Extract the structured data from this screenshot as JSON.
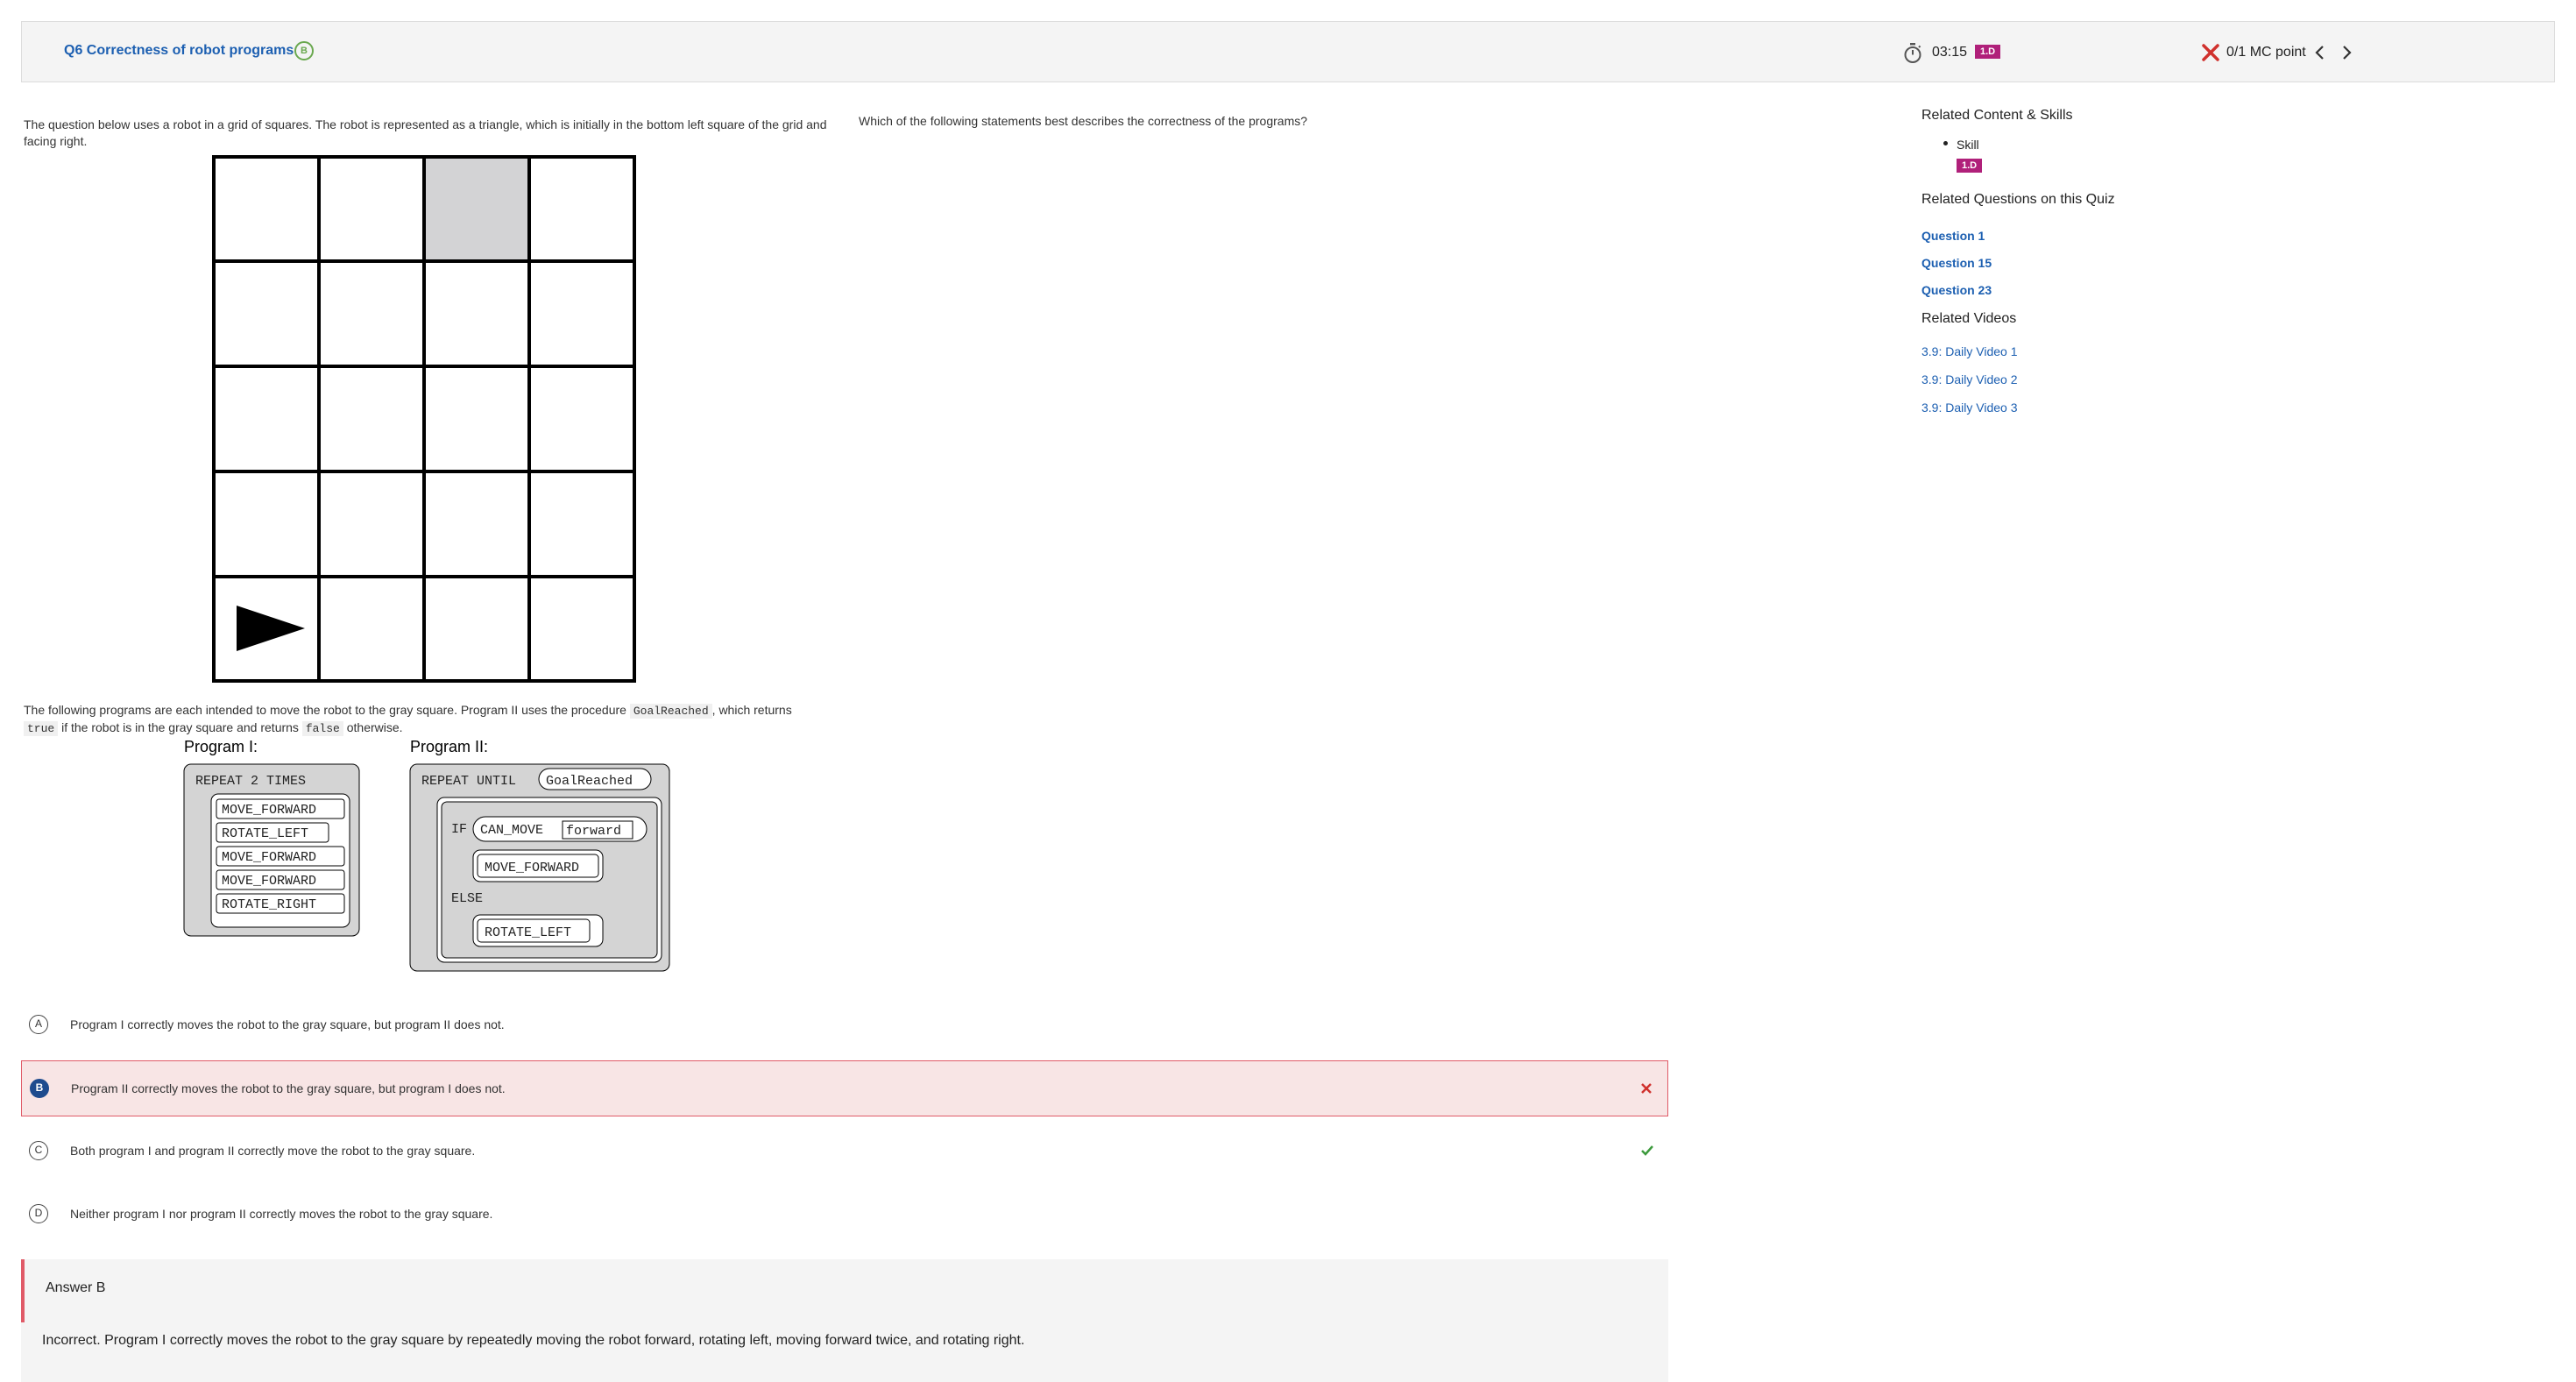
{
  "header": {
    "question_title": "Q6 Correctness of robot programs",
    "status_icon_text": "B",
    "timer": "03:15",
    "badge": "1.D",
    "points": "0/1 MC point"
  },
  "question": {
    "intro": "The question below uses a robot in a grid of squares. The robot is represented as a triangle, which is initially in the bottom left square of the grid and facing right.",
    "prompt": "Which of the following statements best describes the correctness of the programs?",
    "programs_intro": {
      "part1": "The following programs are each intended to move the robot to the gray square. Program II uses the procedure ",
      "code1": "GoalReached",
      "part2": ", which returns ",
      "code2": "true",
      "part3": " if the robot is in the gray square and returns ",
      "code3": "false",
      "part4": " otherwise."
    },
    "program1": {
      "title": "Program I:",
      "header": "REPEAT 2 TIMES",
      "steps": [
        "MOVE_FORWARD",
        "ROTATE_LEFT",
        "MOVE_FORWARD",
        "MOVE_FORWARD",
        "ROTATE_RIGHT"
      ]
    },
    "program2": {
      "title": "Program II:",
      "header": "REPEAT UNTIL",
      "condition": "GoalReached",
      "if_label": "IF",
      "can_move": "CAN_MOVE",
      "forward": "forward",
      "then_step": "MOVE_FORWARD",
      "else_label": "ELSE",
      "else_step": "ROTATE_LEFT"
    }
  },
  "choices": [
    {
      "letter": "A",
      "text": "Program I correctly moves the robot to the gray square, but program II does not."
    },
    {
      "letter": "B",
      "text": "Program II correctly moves the robot to the gray square, but program I does not."
    },
    {
      "letter": "C",
      "text": "Both program I and program II correctly move the robot to the gray square."
    },
    {
      "letter": "D",
      "text": "Neither program I nor program II correctly moves the robot to the gray square."
    }
  ],
  "answer": {
    "heading": "Answer B",
    "explanation": "Incorrect. Program I correctly moves the robot to the gray square by repeatedly moving the robot forward, rotating left, moving forward twice, and rotating right."
  },
  "sidebar": {
    "related_content_heading": "Related Content & Skills",
    "skill_label": "Skill",
    "skill_badge": "1.D",
    "related_questions_heading": "Related Questions on this Quiz",
    "questions": [
      "Question 1",
      "Question 15",
      "Question 23"
    ],
    "related_videos_heading": "Related Videos",
    "videos": [
      "3.9: Daily Video 1",
      "3.9: Daily Video 2",
      "3.9: Daily Video 3"
    ]
  },
  "colors": {
    "link_blue": "#1c5fb1",
    "badge_magenta": "#b0207a",
    "incorrect_red": "#d0312d",
    "correct_green": "#3c9a3c",
    "selected_bg": "#f8e5e5",
    "gray_square": "#d3d3d5"
  },
  "icons": {
    "status": "check-circle-icon",
    "timer": "stopwatch-icon",
    "result": "x-icon",
    "prev": "chevron-left-icon",
    "next": "chevron-right-icon",
    "wrong_mark": "x-mark-icon",
    "right_mark": "checkmark-icon"
  }
}
